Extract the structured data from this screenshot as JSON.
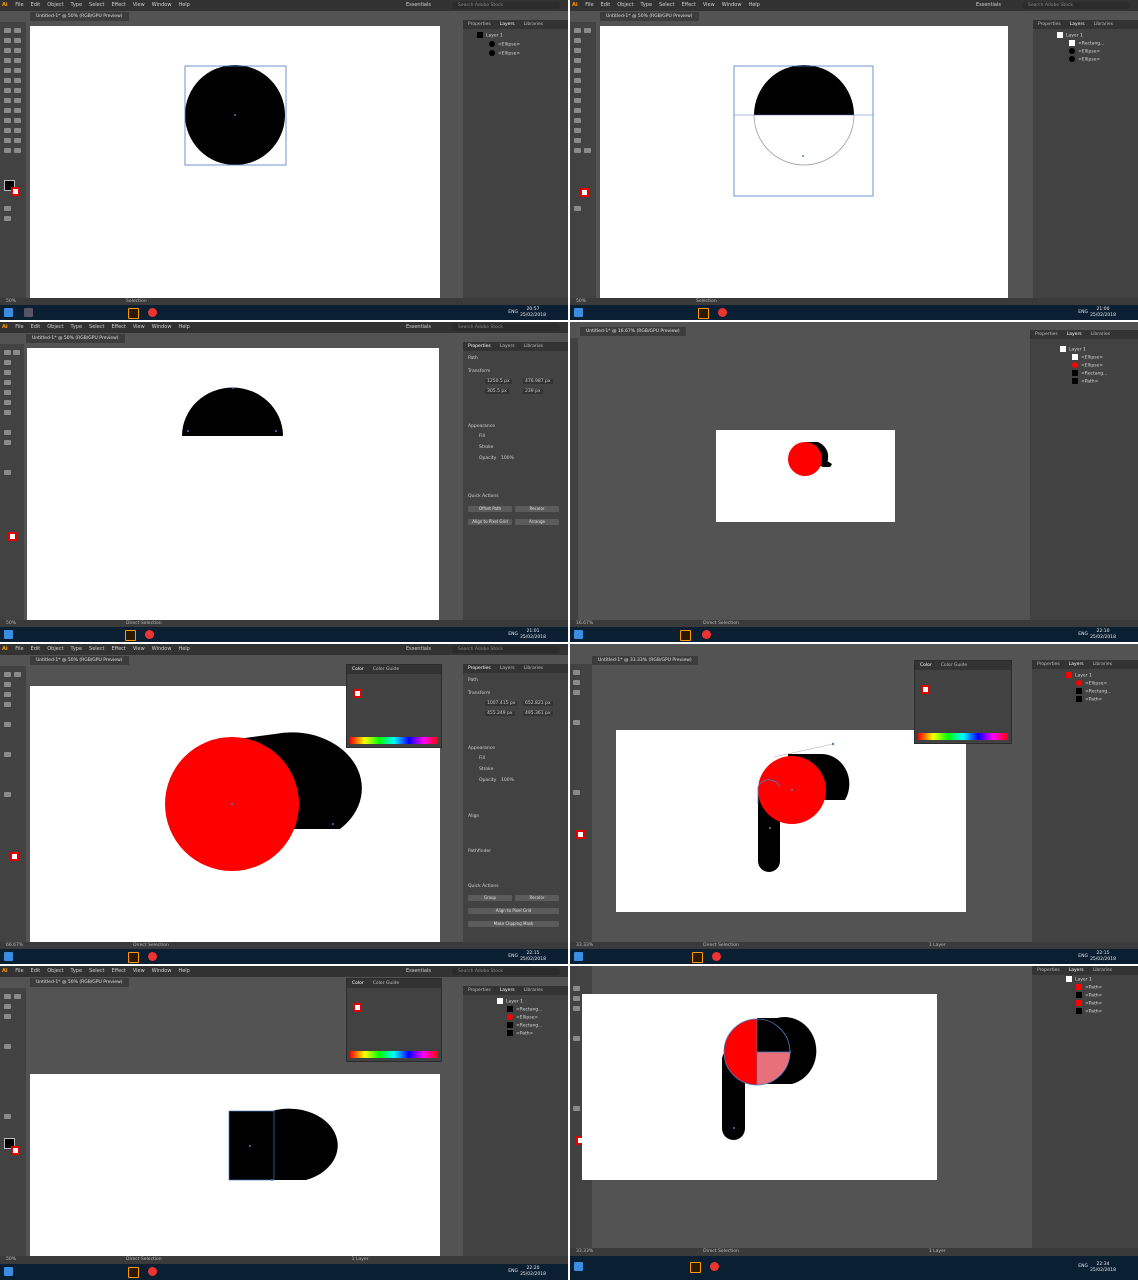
{
  "menu": {
    "app_mark": "Ai",
    "items": [
      "File",
      "Edit",
      "Object",
      "Type",
      "Select",
      "Effect",
      "View",
      "Window",
      "Help"
    ],
    "workspace": "Essentials",
    "search_placeholder": "Search Adobe Stock"
  },
  "panel_tabs": {
    "properties": "Properties",
    "layers": "Layers",
    "libraries": "Libraries",
    "color": "Color",
    "color_guide": "Color Guide"
  },
  "layers": {
    "layer1": "Layer 1",
    "ellipse": "<Ellipse>",
    "rectangle": "<Rectang...",
    "path": "<Path>"
  },
  "documents": {
    "doc_50": "Untitled-1* @ 50% (RGB/GPU Preview)",
    "doc_16": "Untitled-1* @ 16.67% (RGB/GPU Preview)",
    "doc_33": "Untitled-1* @ 33.33% (RGB/GPU Preview)"
  },
  "status": {
    "zoom_50": "50%",
    "zoom_16": "16.67%",
    "zoom_66": "66.67%",
    "zoom_33": "33.33%",
    "tool_selection": "Selection",
    "tool_direct": "Direct Selection",
    "layer_count": "1 Layer"
  },
  "properties": {
    "path": "Path",
    "transform": "Transform",
    "appearance": "Appearance",
    "fill": "Fill",
    "stroke": "Stroke",
    "opacity": "Opacity",
    "opacity_value": "100%",
    "quick_actions": "Quick Actions",
    "offset_path": "Offset Path",
    "recolor": "Recolor",
    "align_pixel": "Align to Pixel Grid",
    "arrange": "Arrange",
    "align": "Align",
    "pathfinder": "Pathfinder",
    "group": "Group",
    "make_clipping": "Make Clipping Mask",
    "x_a": "1250.5 px",
    "y_a": "305.5 px",
    "w_a": "476.987 px",
    "h_a": "239 px",
    "x_b": "1007.415 px",
    "y_b": "455.249 px",
    "w_b": "652.821 px",
    "h_b": "495.361 px"
  },
  "taskbar": {
    "lang": "ENG",
    "date": "25/02/2018",
    "times": [
      "20:57",
      "21:00",
      "21:01",
      "22:10",
      "22:15",
      "22:15",
      "22:20",
      "22:34"
    ]
  },
  "colors": {
    "red": "#ff0000",
    "black": "#000000",
    "ui_dark": "#535353",
    "selection": "#4a7cc4"
  }
}
